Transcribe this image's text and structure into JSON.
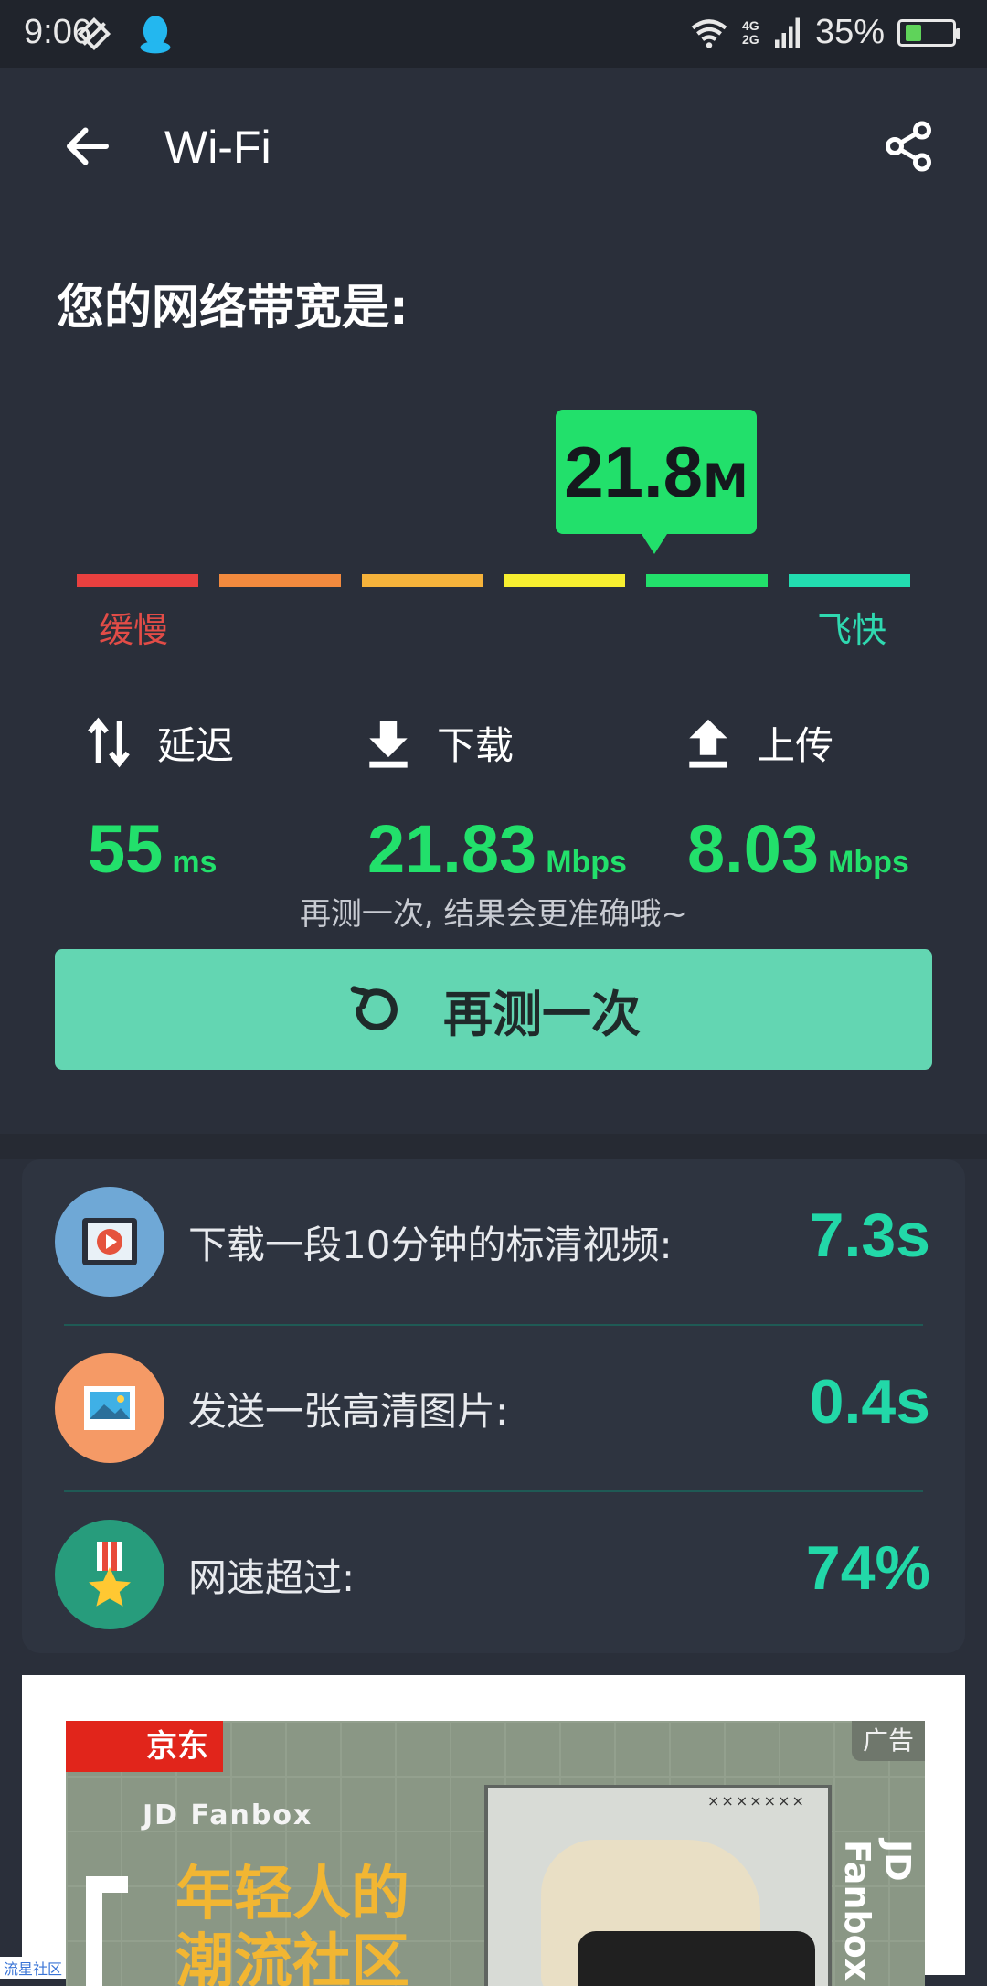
{
  "status": {
    "time": "9:06",
    "network": "4G 2G",
    "battery": "35%",
    "battery_level": 0.35
  },
  "appbar": {
    "title": "Wi-Fi",
    "back_icon": "arrow-left-icon",
    "share_icon": "share-icon"
  },
  "heading": "您的网络带宽是:",
  "gauge": {
    "value": "21.8",
    "unit": "M",
    "slow_label": "缓慢",
    "fast_label": "飞快",
    "active_segment_index": 4,
    "segment_colors": [
      "#e9403f",
      "#f28a3e",
      "#f6b33b",
      "#f7ef30",
      "#22e06b",
      "#22ddb0"
    ]
  },
  "stats": {
    "latency": {
      "label": "延迟",
      "value": "55",
      "unit": "ms"
    },
    "download": {
      "label": "下载",
      "value": "21.83",
      "unit": "Mbps"
    },
    "upload": {
      "label": "上传",
      "value": "8.03",
      "unit": "Mbps"
    }
  },
  "hint": "再测一次, 结果会更准确哦~",
  "retest_label": "再测一次",
  "results": [
    {
      "text": "下载一段10分钟的标清视频:",
      "value": "7.3s",
      "icon": "video-icon",
      "icon_bg": "#6fa8d6"
    },
    {
      "text": "发送一张高清图片:",
      "value": "0.4s",
      "icon": "picture-icon",
      "icon_bg": "#f59a66"
    },
    {
      "text": "网速超过:",
      "value": "74%",
      "icon": "medal-icon",
      "icon_bg": "#279c7c"
    }
  ],
  "ad": {
    "brand": "京东",
    "tag": "广告",
    "fanbox": "JD Fanbox",
    "slogan_line1": "年轻人的",
    "slogan_line2": "潮流社区",
    "vertical": "JD Fanbox",
    "box_text": "×××××××"
  },
  "watermark": "流星社区"
}
